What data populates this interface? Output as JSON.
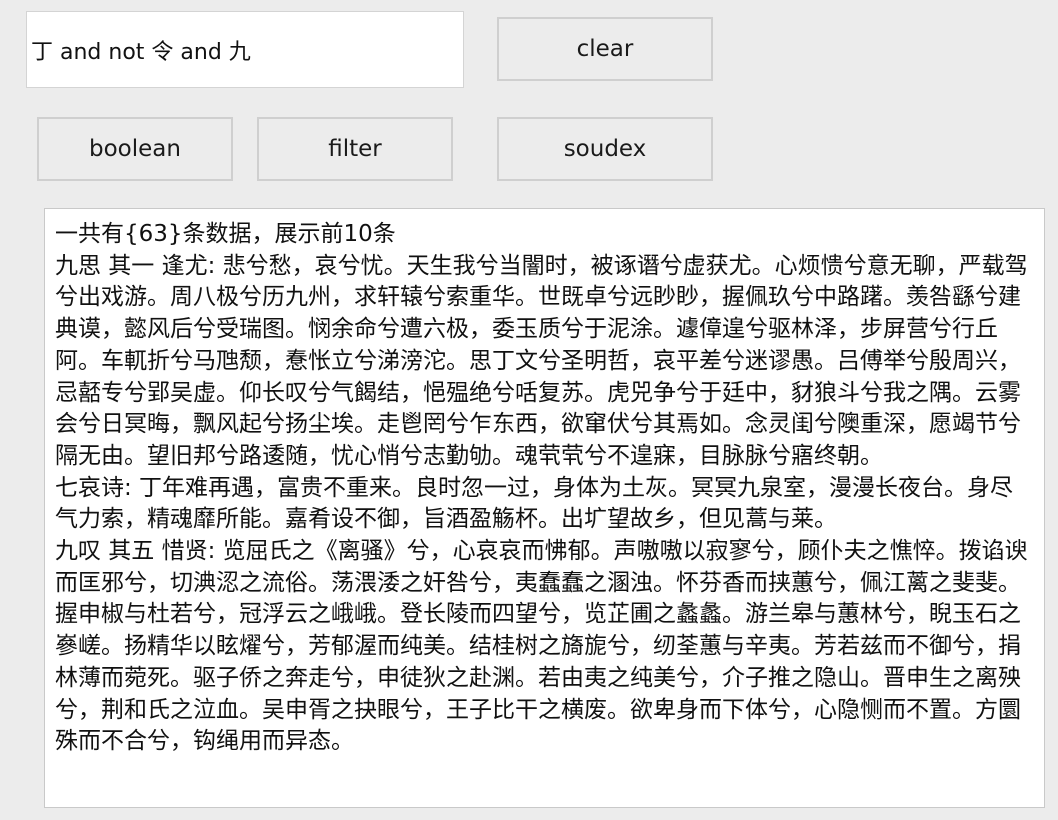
{
  "search": {
    "query": "丁 and not 令 and 九"
  },
  "buttons": {
    "clear": "clear",
    "boolean": "boolean",
    "filter": "filter",
    "soudex": "soudex"
  },
  "results": {
    "text": "一共有{63}条数据，展示前10条\n九思 其一 逢尤: 悲兮愁，哀兮忧。天生我兮当闇时，被诼谮兮虚获尤。心烦愦兮意无聊，严载驾兮出戏游。周八极兮历九州，求轩辕兮索重华。世既卓兮远眇眇，握佩玖兮中路躇。羡咎繇兮建典谟，懿风后兮受瑞图。悯余命兮遭六极，委玉质兮于泥涂。遽傽遑兮驱林泽，步屏营兮行丘阿。车軏折兮马虺颓，惷怅立兮涕滂沱。思丁文兮圣明哲，哀平差兮迷谬愚。吕傅举兮殷周兴，忌嚭专兮郢吴虚。仰长叹兮气餲结，悒殟绝兮咶复苏。虎兕争兮于廷中，豺狼斗兮我之隅。云雾会兮日冥晦，飘风起兮扬尘埃。走鬯罔兮乍东西，欲窜伏兮其焉如。念灵闺兮隩重深，愿竭节兮隔无由。望旧邦兮路逶随，忧心悄兮志勤劬。魂茕茕兮不遑寐，目脉脉兮寤终朝。\n七哀诗: 丁年难再遇，富贵不重来。良时忽一过，身体为土灰。冥冥九泉室，漫漫长夜台。身尽气力索，精魂靡所能。嘉肴设不御，旨酒盈觞杯。出圹望故乡，但见蒿与莱。\n九叹 其五 惜贤: 览屈氏之《离骚》兮，心哀哀而怫郁。声嗷嗷以寂寥兮，顾仆夫之憔悴。拨谄谀而匡邪兮，切淟涊之流俗。荡渨涹之奸咎兮，夷蠢蠢之溷浊。怀芬香而挟蕙兮，佩江蓠之斐斐。握申椒与杜若兮，冠浮云之峨峨。登长陵而四望兮，览芷圃之蠡蠡。游兰皋与蕙林兮，睨玉石之嵾嵯。扬精华以眩燿兮，芳郁渥而纯美。结桂树之旖旎兮，纫荃蕙与辛夷。芳若兹而不御兮，捐林薄而菀死。驱子侨之奔走兮，申徒狄之赴渊。若由夷之纯美兮，介子推之隐山。晋申生之离殃兮，荆和氏之泣血。吴申胥之抉眼兮，王子比干之横废。欲卑身而下体兮，心隐恻而不置。方圜殊而不合兮，钩绳用而异态。"
  }
}
